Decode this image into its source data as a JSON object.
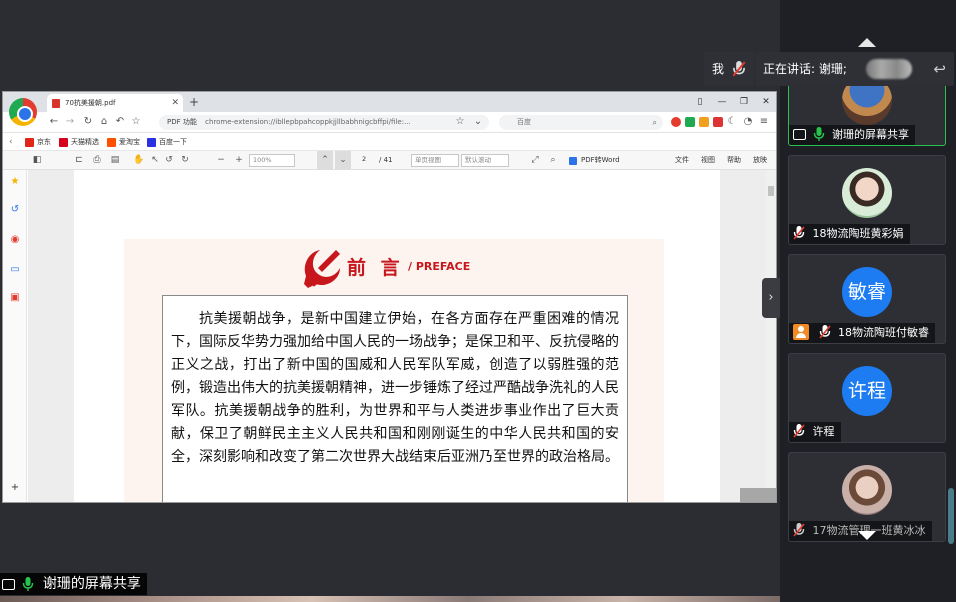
{
  "colors": {
    "accent_green": "#26c44d",
    "avatar_blue": "#1d7cf2",
    "party_red": "#c8161d",
    "panel_bg": "#1f2025"
  },
  "browser": {
    "tab_title": "70抗美援朝.pdf",
    "address_label": "PDF 功能",
    "address_url": "chrome-extension://ibllepbpahcoppkjjllbabhnigcbffpi/file:...",
    "search_engine": "百度",
    "bookmarks": [
      "京东",
      "天猫精选",
      "爱淘宝",
      "百度一下"
    ]
  },
  "pdf_toolbar": {
    "zoom": "100%",
    "page_current": "2",
    "page_total": "/ 41",
    "view_mode": "单页视图",
    "scroll_mode": "默认滚动",
    "convert_label": "PDF转Word",
    "menus": [
      "文件",
      "视图",
      "帮助",
      "放映"
    ]
  },
  "document": {
    "title_cn": "前 言",
    "title_en": "/ PREFACE",
    "paragraph": "抗美援朝战争，是新中国建立伊始，在各方面存在严重困难的情况下，国际反华势力强加给中国人民的一场战争；是保卫和平、反抗侵略的正义之战，打出了新中国的国威和人民军队军威，创造了以弱胜强的范例，锻造出伟大的抗美援朝精神，进一步锤炼了经过严酷战争洗礼的人民军队。抗美援朝战争的胜利，为世界和平与人类进步事业作出了巨大贡献，保卫了朝鲜民主主义人民共和国和刚刚诞生的中华人民共和国的安全，深刻影响和改变了第二次世界大战结束后亚洲乃至世界的政治格局。"
  },
  "meeting": {
    "me_label": "我",
    "speaking_label": "正在讲话: 谢珊;",
    "participants": [
      {
        "name": "谢珊的屏幕共享",
        "active": true
      },
      {
        "name": "18物流陶班黄彩娟"
      },
      {
        "name": "18物流陶班付敏睿",
        "avatar_text": "敏睿"
      },
      {
        "name": "许程",
        "avatar_text": "许程"
      },
      {
        "name": "17物流管理一班黄冰冰"
      }
    ],
    "share_label": "谢珊的屏幕共享"
  }
}
